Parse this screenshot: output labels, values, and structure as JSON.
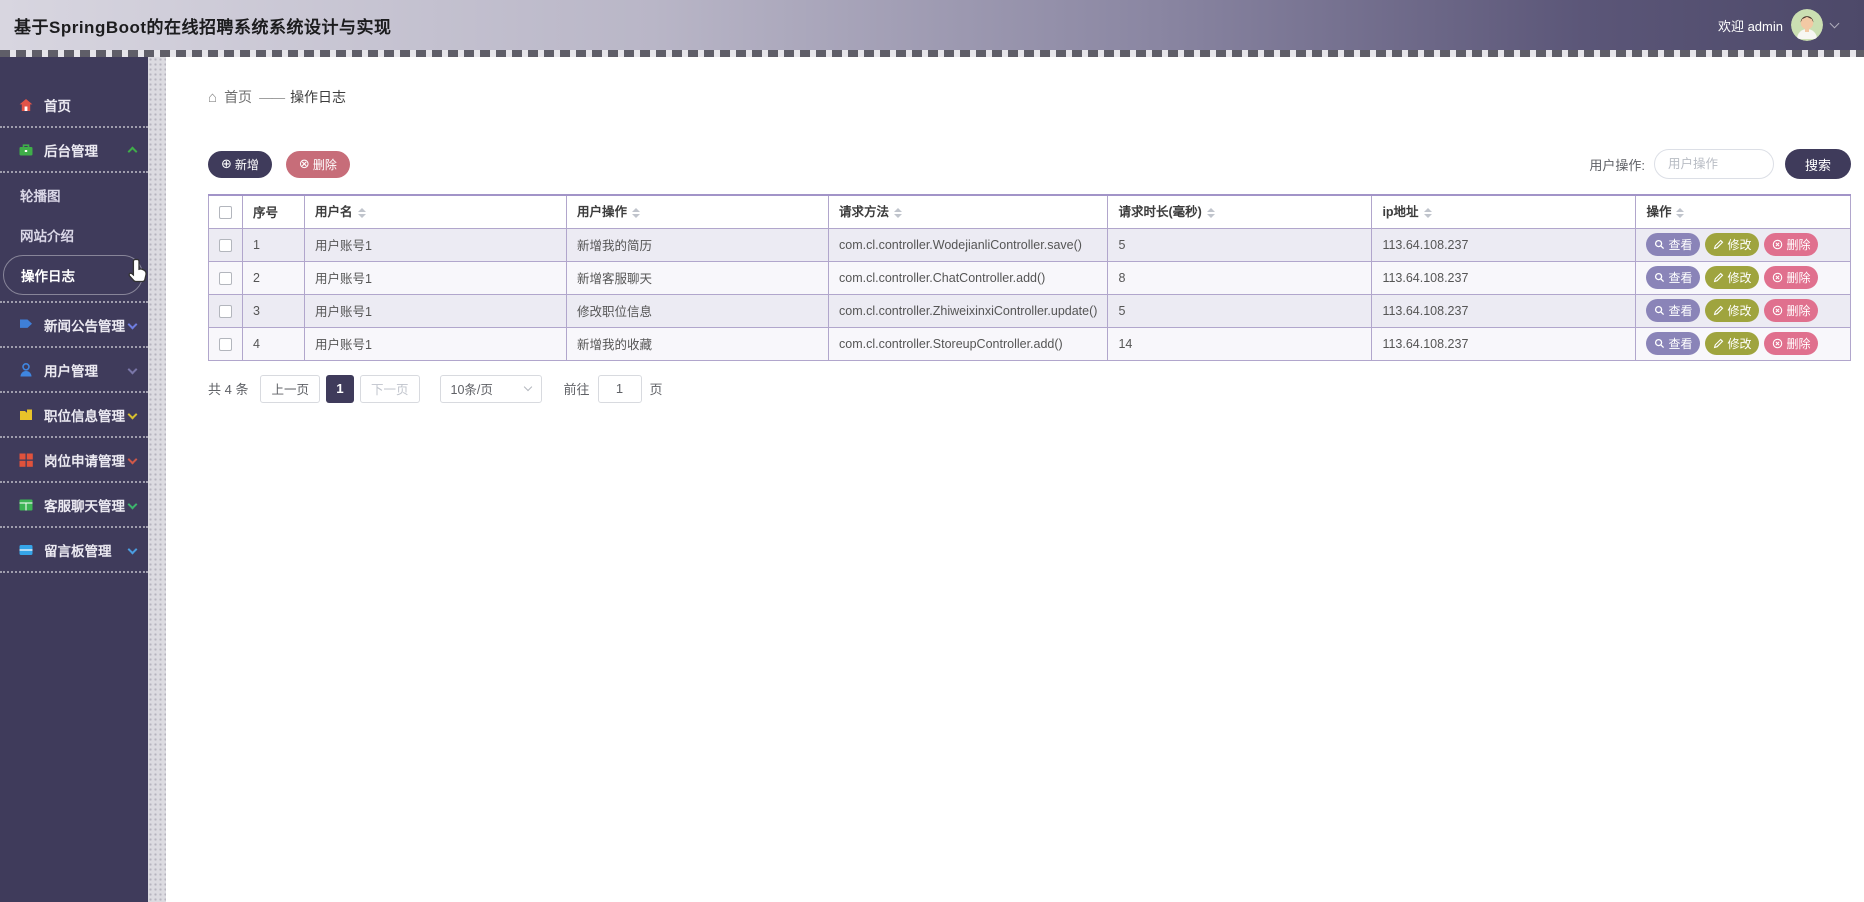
{
  "header": {
    "title": "基于SpringBoot的在线招聘系统系统设计与实现",
    "welcome_text": "欢迎 admin"
  },
  "breadcrumb": {
    "home": "首页",
    "separator": "——",
    "current": "操作日志"
  },
  "sidebar": {
    "items": [
      {
        "label": "首页",
        "icon": "home-icon"
      },
      {
        "label": "后台管理",
        "icon": "briefcase-icon",
        "expanded": true,
        "children": [
          "轮播图",
          "网站介绍",
          "操作日志"
        ]
      },
      {
        "label": "新闻公告管理",
        "icon": "news-icon"
      },
      {
        "label": "用户管理",
        "icon": "user-icon"
      },
      {
        "label": "职位信息管理",
        "icon": "job-icon"
      },
      {
        "label": "岗位申请管理",
        "icon": "apply-grid-icon"
      },
      {
        "label": "客服聊天管理",
        "icon": "chat-grid-icon"
      },
      {
        "label": "留言板管理",
        "icon": "message-board-icon"
      }
    ],
    "active_item": "操作日志"
  },
  "toolbar": {
    "add_label": "新增",
    "add_icon": "plus-circle-icon",
    "delete_label": "删除",
    "delete_icon": "x-circle-icon",
    "search_label": "用户操作:",
    "search_placeholder": "用户操作",
    "search_button": "搜索"
  },
  "table": {
    "headers": [
      "序号",
      "用户名",
      "用户操作",
      "请求方法",
      "请求时长(毫秒)",
      "ip地址",
      "操作"
    ],
    "rows": [
      {
        "index": "1",
        "username": "用户账号1",
        "operation": "新增我的简历",
        "method": "com.cl.controller.WodejianliController.save()",
        "duration": "5",
        "ip": "113.64.108.237"
      },
      {
        "index": "2",
        "username": "用户账号1",
        "operation": "新增客服聊天",
        "method": "com.cl.controller.ChatController.add()",
        "duration": "8",
        "ip": "113.64.108.237"
      },
      {
        "index": "3",
        "username": "用户账号1",
        "operation": "修改职位信息",
        "method": "com.cl.controller.ZhiweixinxiController.update()",
        "duration": "5",
        "ip": "113.64.108.237"
      },
      {
        "index": "4",
        "username": "用户账号1",
        "operation": "新增我的收藏",
        "method": "com.cl.controller.StoreupController.add()",
        "duration": "14",
        "ip": "113.64.108.237"
      }
    ],
    "actions": {
      "view": "查看",
      "edit": "修改",
      "del": "删除"
    }
  },
  "pagination": {
    "total": "共 4 条",
    "prev": "上一页",
    "page": "1",
    "next": "下一页",
    "page_size": "10条/页",
    "goto_prefix": "前往",
    "goto_value": "1",
    "goto_suffix": "页"
  },
  "colors": {
    "accent": "#3f3b5b",
    "danger": "#c76d79",
    "view_button": "#8a84b8",
    "edit_button": "#9fa43e",
    "delete_button": "#e0708e",
    "sidebar_bg": "#3f3b5b",
    "table_border": "#b1a6cc"
  }
}
